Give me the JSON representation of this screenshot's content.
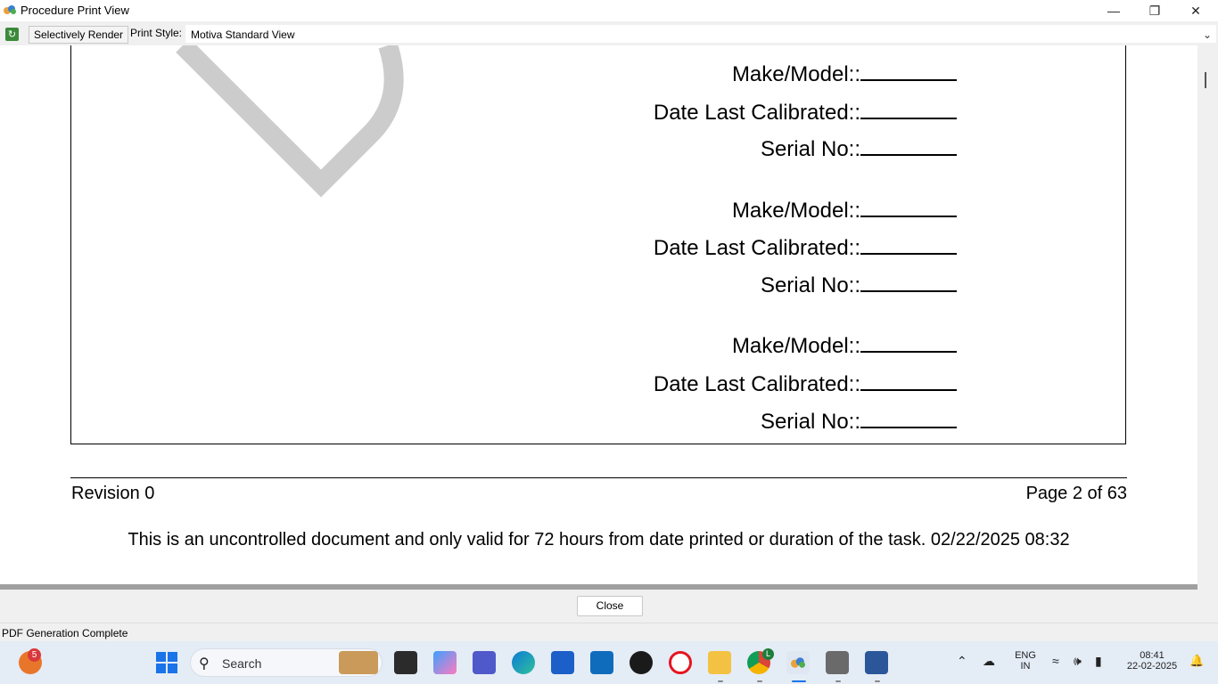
{
  "window": {
    "title": "Procedure Print View",
    "minimize_glyph": "—",
    "maximize_glyph": "❐",
    "close_glyph": "✕"
  },
  "toolbar": {
    "refresh_icon": "refresh-icon",
    "selectively_render_label": "Selectively Render",
    "print_style_label": "Print Style:",
    "print_style_value": "Motiva Standard View",
    "chevron": "⌄"
  },
  "document": {
    "fields": [
      {
        "label": "Make/Model::"
      },
      {
        "label": "Date Last Calibrated::"
      },
      {
        "label": "Serial No::"
      },
      {
        "label": "Make/Model::"
      },
      {
        "label": "Date Last Calibrated::"
      },
      {
        "label": "Serial No::"
      },
      {
        "label": "Make/Model::"
      },
      {
        "label": "Date Last Calibrated::"
      },
      {
        "label": "Serial No::"
      }
    ],
    "footer": {
      "revision": "Revision 0",
      "page": "Page 2 of 63",
      "notice": "This is an uncontrolled document and only valid for 72 hours from date printed or duration of the task. 02/22/2025 08:32"
    }
  },
  "close_button_label": "Close",
  "status": "PDF Generation Complete",
  "taskbar": {
    "notification_badge": "5",
    "search_placeholder": "Search",
    "language": "ENG",
    "region": "IN",
    "time": "08:41",
    "date": "22-02-2025",
    "chrome_badge": "L"
  }
}
